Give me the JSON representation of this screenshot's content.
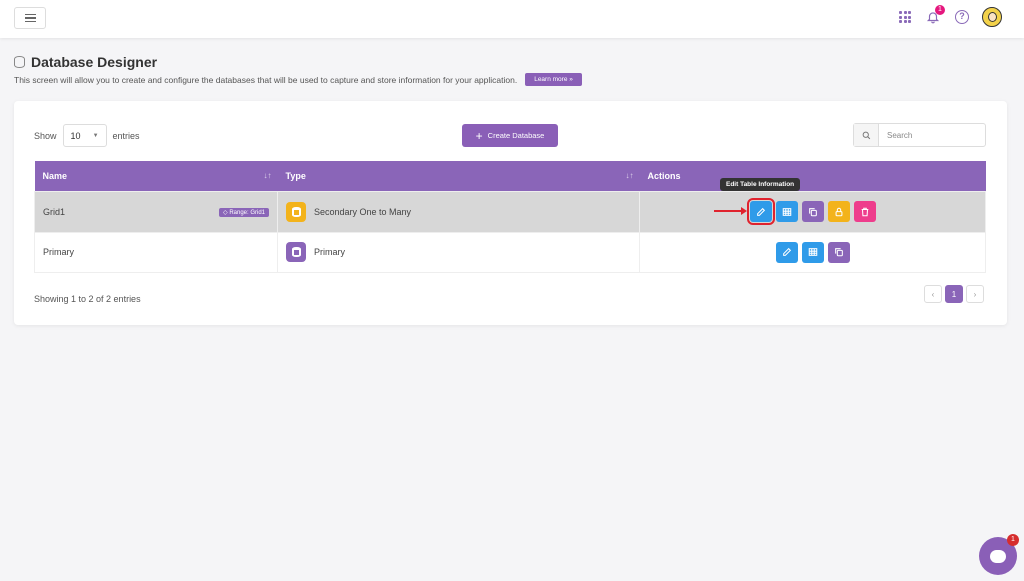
{
  "topbar": {
    "notification_count": "1",
    "help_symbol": "?"
  },
  "page": {
    "title": "Database Designer",
    "description": "This screen will allow you to create and configure the databases that will be used to capture and store information for your application.",
    "learn_more": "Learn more »"
  },
  "controls": {
    "show_label": "Show",
    "entries_value": "10",
    "entries_label": "entries",
    "create_label": "Create Database",
    "search_placeholder": "Search"
  },
  "table": {
    "columns": [
      "Name",
      "Type",
      "Actions"
    ],
    "rows": [
      {
        "name": "Grid1",
        "badge": "Range: Grid1",
        "type": "Secondary One to Many",
        "type_color": "#f3b31b"
      },
      {
        "name": "Primary",
        "badge": "",
        "type": "Primary",
        "type_color": "#8a65b8"
      }
    ]
  },
  "tooltip": "Edit Table Information",
  "footer": {
    "info": "Showing 1 to 2 of 2 entries",
    "prev": "‹",
    "page": "1",
    "next": "›"
  },
  "chat": {
    "badge": "1"
  },
  "colors": {
    "accent": "#8a65b8",
    "action_blue": "#2f9be9",
    "action_orange": "#f3b31b",
    "action_pink": "#ee3d8c",
    "highlight_red": "#e0232e"
  }
}
